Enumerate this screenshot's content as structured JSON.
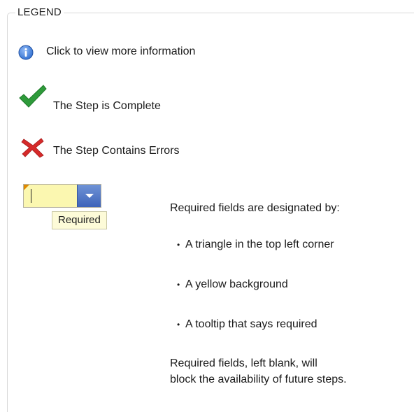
{
  "legend": {
    "title": "LEGEND",
    "items": [
      {
        "icon": "info-icon",
        "text": "Click to view more information"
      },
      {
        "icon": "checkmark-icon",
        "text": "The Step is Complete"
      },
      {
        "icon": "error-x-icon",
        "text": "The Step Contains Errors"
      }
    ]
  },
  "sample_field": {
    "value": "",
    "tooltip": "Required",
    "button_icon": "chevron-down-icon"
  },
  "required": {
    "heading": "Required fields are designated by:",
    "bullets": [
      "A triangle in the top left corner",
      "A yellow background",
      "A tooltip that says required"
    ],
    "note_line1": "Required fields, left blank, will",
    "note_line2": "block the availability of future steps."
  },
  "colors": {
    "info_blue": "#2f6fd0",
    "check_green": "#2e9a3a",
    "error_red": "#d62a2a",
    "required_yellow": "#fbf7b0",
    "required_corner": "#e08a00",
    "dropdown_blue": "#4a6fc2"
  }
}
